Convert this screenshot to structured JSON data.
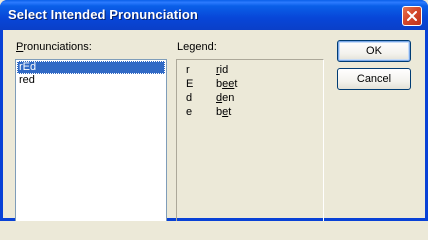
{
  "window": {
    "title": "Select Intended Pronunciation"
  },
  "pronunciations": {
    "label_key": "P",
    "label_rest": "ronunciations:",
    "items": [
      "rEd",
      "red"
    ],
    "selected_index": 0
  },
  "legend": {
    "label": "Legend:",
    "rows": [
      {
        "symbol": "r",
        "key": "r",
        "word_rest": "id"
      },
      {
        "symbol": "E",
        "key": "",
        "word_pre": "b",
        "word_key": "ee",
        "word_rest": "t"
      },
      {
        "symbol": "d",
        "key": "d",
        "word_rest": "en"
      },
      {
        "symbol": "e",
        "key": "",
        "word_pre": "b",
        "word_key": "e",
        "word_rest": "t"
      }
    ]
  },
  "buttons": {
    "ok": "OK",
    "cancel": "Cancel"
  },
  "colors": {
    "title_bar": "#0a5fe8",
    "selection": "#316ac5",
    "dialog_bg": "#ece9d8"
  }
}
